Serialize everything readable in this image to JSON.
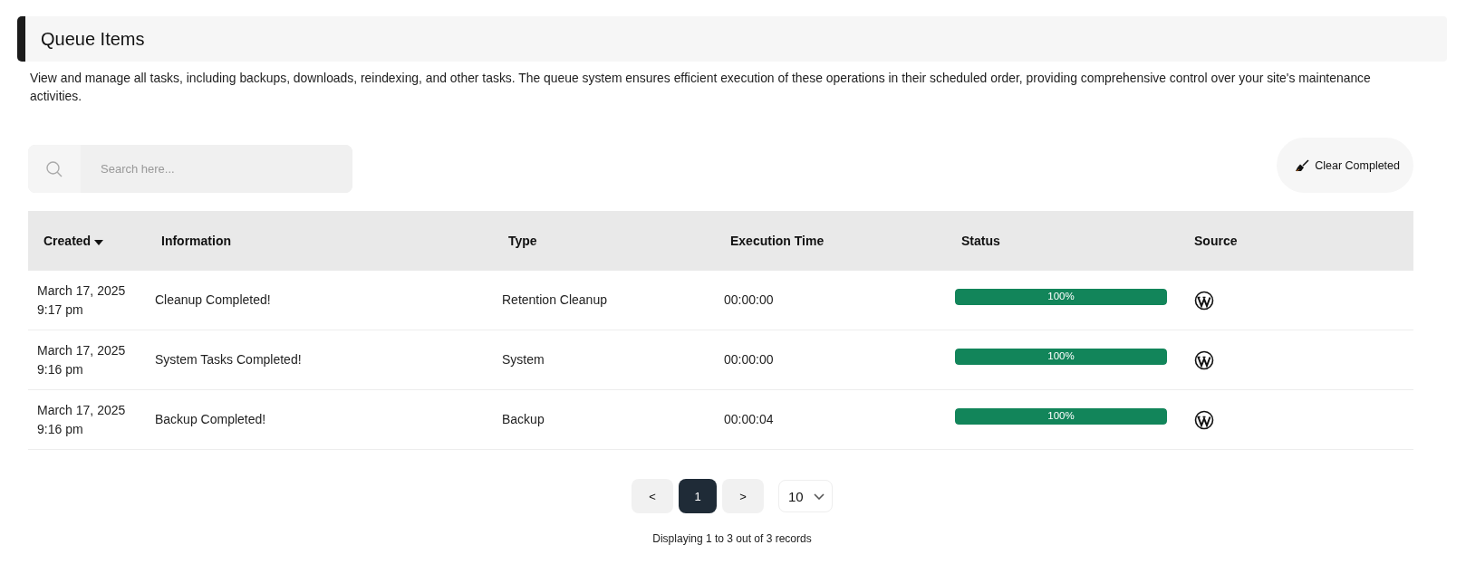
{
  "header": {
    "title": "Queue Items",
    "description": "View and manage all tasks, including backups, downloads, reindexing, and other tasks. The queue system ensures efficient execution of these operations in their scheduled order, providing comprehensive control over your site's maintenance activities."
  },
  "search": {
    "placeholder": "Search here..."
  },
  "clear_button": {
    "label": "Clear Completed"
  },
  "table": {
    "columns": [
      {
        "label": "Created",
        "sorted": true
      },
      {
        "label": "Information",
        "sorted": false
      },
      {
        "label": "Type",
        "sorted": false
      },
      {
        "label": "Execution Time",
        "sorted": false
      },
      {
        "label": "Status",
        "sorted": false
      },
      {
        "label": "Source",
        "sorted": false
      }
    ],
    "rows": [
      {
        "created": "March 17, 2025 9:17 pm",
        "information": "Cleanup Completed!",
        "type": "Retention Cleanup",
        "execution_time": "00:00:00",
        "status": {
          "level": 1,
          "label": "100%"
        }
      },
      {
        "created": "March 17, 2025 9:16 pm",
        "information": "System Tasks Completed!",
        "type": "System",
        "execution_time": "00:00:00",
        "status": {
          "level": 1,
          "label": "100%"
        }
      },
      {
        "created": "March 17, 2025 9:16 pm",
        "information": "Backup Completed!",
        "type": "Backup",
        "execution_time": "00:00:04",
        "status": {
          "level": 1,
          "label": "100%"
        }
      }
    ]
  },
  "pagination": {
    "prev": "<",
    "pages": [
      {
        "label": "1",
        "selected": true
      }
    ],
    "next": ">",
    "per_page": "10",
    "summary": "Displaying 1 to 3 out of 3 records"
  }
}
